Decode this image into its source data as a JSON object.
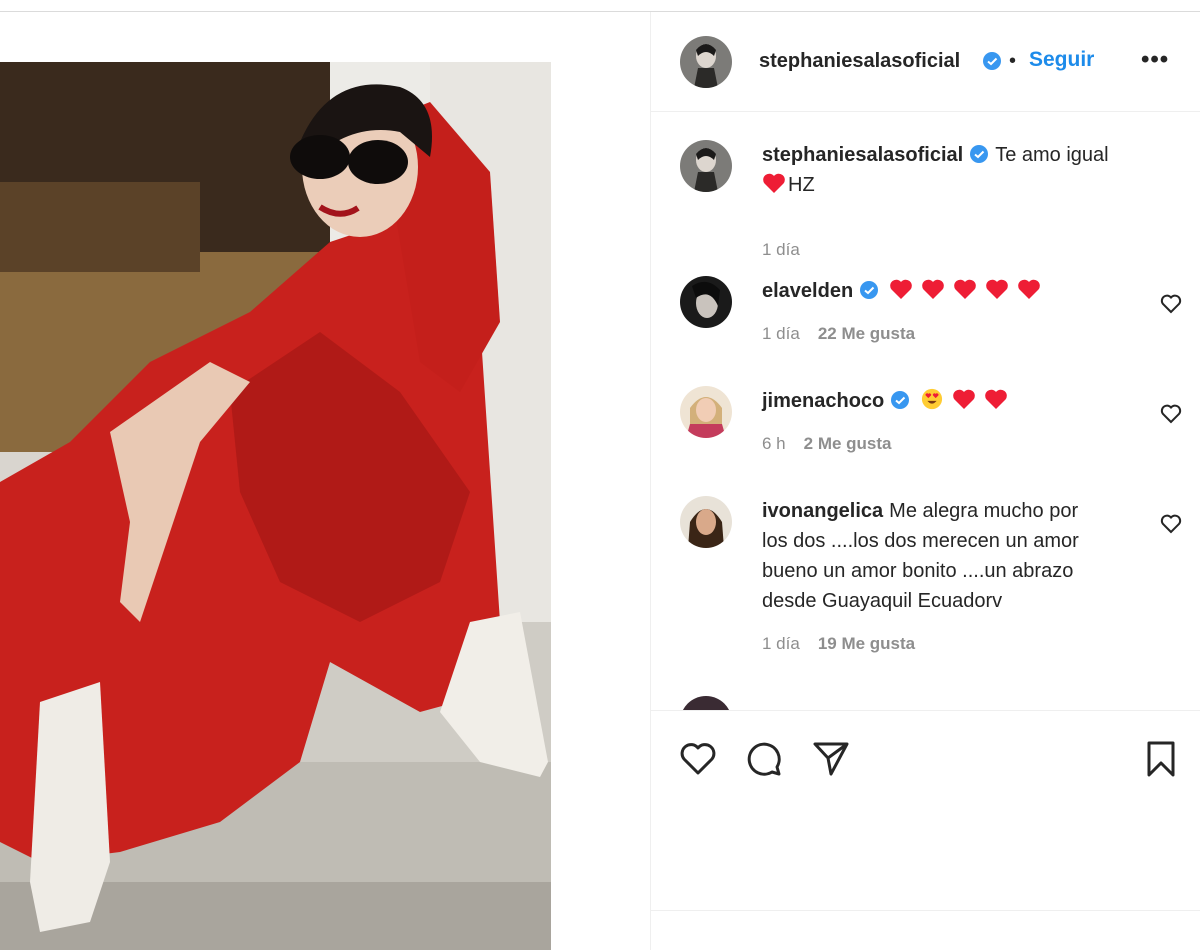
{
  "post": {
    "author": "stephaniesalasoficial",
    "follow_label": "Seguir",
    "dot": "•",
    "more_label": "•••"
  },
  "caption": {
    "username": "stephaniesalasoficial",
    "text": "Te amo igual",
    "line2": "HZ",
    "time": "1 día"
  },
  "comments": [
    {
      "username": "elavelden",
      "verified": true,
      "emojis": [
        "red-heart",
        "red-heart",
        "red-heart",
        "red-heart",
        "red-heart"
      ],
      "time": "1 día",
      "likes": "22 Me gusta"
    },
    {
      "username": "jimenachoco",
      "verified": true,
      "emojis": [
        "heart-eyes",
        "red-heart",
        "red-heart"
      ],
      "time": "6 h",
      "likes": "2 Me gusta"
    },
    {
      "username": "ivonangelica",
      "verified": false,
      "text_lines": [
        "Me alegra mucho por",
        "los dos ....los dos merecen un amor",
        "bueno un amor bonito ....un abrazo",
        "desde Guayaquil Ecuadorv"
      ],
      "time": "1 día",
      "likes": "19 Me gusta"
    }
  ],
  "actions": [
    "like-icon",
    "comment-icon",
    "share-icon",
    "save-icon"
  ],
  "colors": {
    "accent": "#1d8bea",
    "heart": "#ee1d35",
    "text": "#262626",
    "muted": "#8e8e8e",
    "dress": "#c8211d"
  }
}
